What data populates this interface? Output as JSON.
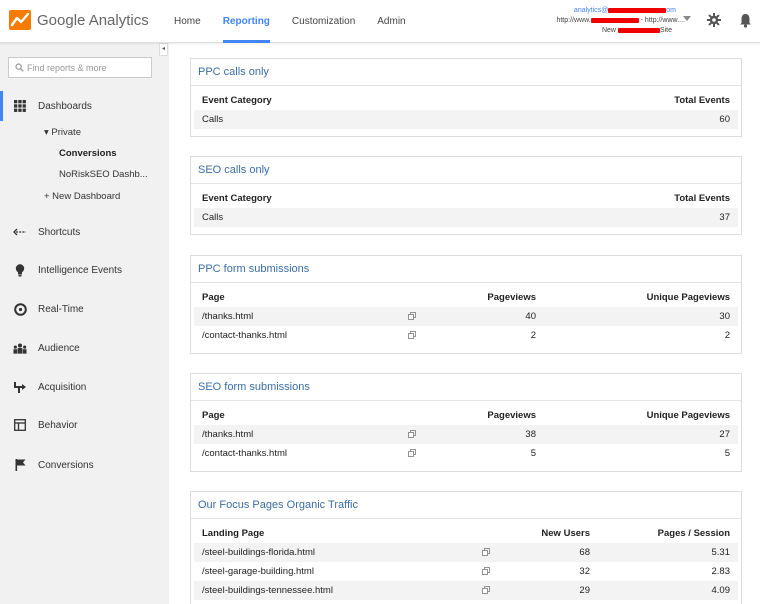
{
  "app": {
    "logo_text": "Google Analytics",
    "brand_color": "#f57c00",
    "accent_color": "#4285f4"
  },
  "nav": {
    "items": [
      {
        "label": "Home"
      },
      {
        "label": "Reporting"
      },
      {
        "label": "Customization"
      },
      {
        "label": "Admin"
      }
    ],
    "active": "Reporting"
  },
  "account": {
    "email_prefix": "analytics@",
    "email_suffix": "om",
    "property_prefix": "http://www.",
    "property_suffix": " - http://www....",
    "view_prefix": "New ",
    "view_suffix": "Site"
  },
  "sidebar": {
    "search_placeholder": "Find reports & more",
    "collapse_glyph": "◂",
    "items": [
      {
        "label": "Dashboards",
        "icon": "dashboard-grid-icon"
      },
      {
        "label": "Shortcuts",
        "icon": "shortcut-arrow-icon"
      },
      {
        "label": "Intelligence Events",
        "icon": "lightbulb-icon"
      },
      {
        "label": "Real-Time",
        "icon": "realtime-clock-icon"
      },
      {
        "label": "Audience",
        "icon": "audience-people-icon"
      },
      {
        "label": "Acquisition",
        "icon": "acquisition-arrow-icon"
      },
      {
        "label": "Behavior",
        "icon": "behavior-layout-icon"
      },
      {
        "label": "Conversions",
        "icon": "conversions-flag-icon"
      }
    ],
    "private_label": "▾ Private",
    "dashboards": [
      "Conversions",
      "NoRiskSEO Dashb..."
    ],
    "new_dashboard": "+ New Dashboard"
  },
  "cards": [
    {
      "title": "PPC calls only",
      "headers": [
        "Event Category",
        "Total Events"
      ],
      "rows": [
        [
          "Calls",
          "60"
        ]
      ]
    },
    {
      "title": "SEO calls only",
      "headers": [
        "Event Category",
        "Total Events"
      ],
      "rows": [
        [
          "Calls",
          "37"
        ]
      ]
    },
    {
      "title": "PPC form submissions",
      "headers": [
        "Page",
        "Pageviews",
        "Unique Pageviews"
      ],
      "rows": [
        [
          "/thanks.html",
          "40",
          "30"
        ],
        [
          "/contact-thanks.html",
          "2",
          "2"
        ]
      ]
    },
    {
      "title": "SEO form submissions",
      "headers": [
        "Page",
        "Pageviews",
        "Unique Pageviews"
      ],
      "rows": [
        [
          "/thanks.html",
          "38",
          "27"
        ],
        [
          "/contact-thanks.html",
          "5",
          "5"
        ]
      ]
    },
    {
      "title": "Our Focus Pages Organic Traffic",
      "headers": [
        "Landing Page",
        "New Users",
        "Pages / Session"
      ],
      "rows": [
        [
          "/steel-buildings-florida.html",
          "68",
          "5.31"
        ],
        [
          "/steel-garage-building.html",
          "32",
          "2.83"
        ],
        [
          "/steel-buildings-tennessee.html",
          "29",
          "4.09"
        ]
      ]
    }
  ]
}
